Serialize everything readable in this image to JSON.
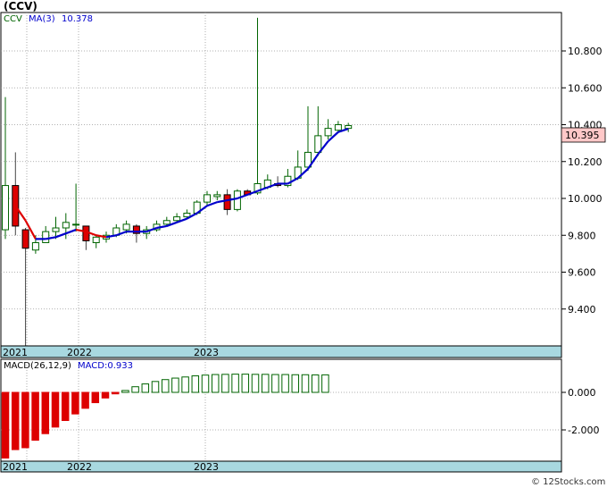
{
  "header": {
    "title": "(CCV)"
  },
  "price_legend": {
    "ticker": "CCV",
    "ma_label": "MA(3)",
    "ma_value": "10.378"
  },
  "last_price_label": "10.395",
  "macd_legend": {
    "label": "MACD(26,12,9)",
    "value_label": "MACD:0.933"
  },
  "credit": "© 12Stocks.com",
  "colors": {
    "up_candle_border": "#006400",
    "down_candle_fill": "#dd0000",
    "ma_up": "#0000cc",
    "ma_down": "#dd0000",
    "macd_pos": "#006400",
    "macd_neg": "#dd0000",
    "axis_band": "#a8d8e0"
  },
  "chart_data": [
    {
      "type": "candlestick",
      "title": "(CCV)",
      "period": "monthly",
      "x_labels": [
        "2021",
        "2022",
        "2023"
      ],
      "ylim": [
        9.2,
        11.0
      ],
      "y_ticks": [
        "9.400",
        "9.600",
        "9.800",
        "10.000",
        "10.200",
        "10.400",
        "10.600",
        "10.800"
      ],
      "grid": true,
      "candles": [
        {
          "o": 9.83,
          "h": 10.55,
          "l": 9.78,
          "c": 10.07
        },
        {
          "o": 10.07,
          "h": 10.25,
          "l": 9.8,
          "c": 9.85
        },
        {
          "o": 9.83,
          "h": 9.84,
          "l": 9.2,
          "c": 9.73
        },
        {
          "o": 9.72,
          "h": 9.8,
          "l": 9.7,
          "c": 9.76
        },
        {
          "o": 9.76,
          "h": 9.85,
          "l": 9.76,
          "c": 9.82
        },
        {
          "o": 9.82,
          "h": 9.9,
          "l": 9.78,
          "c": 9.84
        },
        {
          "o": 9.84,
          "h": 9.92,
          "l": 9.78,
          "c": 9.87
        },
        {
          "o": 9.86,
          "h": 10.08,
          "l": 9.82,
          "c": 9.86
        },
        {
          "o": 9.85,
          "h": 9.85,
          "l": 9.72,
          "c": 9.77
        },
        {
          "o": 9.76,
          "h": 9.8,
          "l": 9.73,
          "c": 9.79
        },
        {
          "o": 9.78,
          "h": 9.82,
          "l": 9.76,
          "c": 9.8
        },
        {
          "o": 9.8,
          "h": 9.86,
          "l": 9.79,
          "c": 9.84
        },
        {
          "o": 9.83,
          "h": 9.88,
          "l": 9.81,
          "c": 9.86
        },
        {
          "o": 9.85,
          "h": 9.86,
          "l": 9.76,
          "c": 9.81
        },
        {
          "o": 9.81,
          "h": 9.85,
          "l": 9.78,
          "c": 9.83
        },
        {
          "o": 9.83,
          "h": 9.88,
          "l": 9.82,
          "c": 9.86
        },
        {
          "o": 9.86,
          "h": 9.9,
          "l": 9.85,
          "c": 9.88
        },
        {
          "o": 9.88,
          "h": 9.92,
          "l": 9.87,
          "c": 9.9
        },
        {
          "o": 9.9,
          "h": 9.94,
          "l": 9.89,
          "c": 9.92
        },
        {
          "o": 9.92,
          "h": 9.99,
          "l": 9.91,
          "c": 9.98
        },
        {
          "o": 9.98,
          "h": 10.04,
          "l": 9.96,
          "c": 10.02
        },
        {
          "o": 10.01,
          "h": 10.04,
          "l": 9.99,
          "c": 10.02
        },
        {
          "o": 10.02,
          "h": 10.05,
          "l": 9.91,
          "c": 9.94
        },
        {
          "o": 9.94,
          "h": 10.05,
          "l": 9.93,
          "c": 10.04
        },
        {
          "o": 10.04,
          "h": 10.05,
          "l": 10.02,
          "c": 10.02
        },
        {
          "o": 10.03,
          "h": 10.98,
          "l": 10.02,
          "c": 10.08
        },
        {
          "o": 10.06,
          "h": 10.13,
          "l": 10.05,
          "c": 10.1
        },
        {
          "o": 10.08,
          "h": 10.12,
          "l": 10.06,
          "c": 10.07
        },
        {
          "o": 10.07,
          "h": 10.16,
          "l": 10.06,
          "c": 10.12
        },
        {
          "o": 10.11,
          "h": 10.26,
          "l": 10.1,
          "c": 10.17
        },
        {
          "o": 10.17,
          "h": 10.5,
          "l": 10.15,
          "c": 10.25
        },
        {
          "o": 10.25,
          "h": 10.5,
          "l": 10.23,
          "c": 10.34
        },
        {
          "o": 10.34,
          "h": 10.43,
          "l": 10.32,
          "c": 10.38
        },
        {
          "o": 10.37,
          "h": 10.42,
          "l": 10.36,
          "c": 10.4
        },
        {
          "o": 10.38,
          "h": 10.41,
          "l": 10.36,
          "c": 10.395
        }
      ],
      "ma": [
        null,
        9.96,
        9.88,
        9.78,
        9.78,
        9.79,
        9.81,
        9.83,
        9.82,
        9.8,
        9.79,
        9.8,
        9.82,
        9.82,
        9.82,
        9.84,
        9.85,
        9.87,
        9.89,
        9.92,
        9.96,
        9.98,
        9.99,
        10.0,
        10.02,
        10.04,
        10.06,
        10.08,
        10.08,
        10.11,
        10.16,
        10.24,
        10.31,
        10.36,
        10.378
      ]
    },
    {
      "type": "bar",
      "title": "MACD(26,12,9)",
      "ylim": [
        -3.6,
        1.8
      ],
      "y_ticks": [
        "0.000",
        "-2.000"
      ],
      "x_labels": [
        "2021",
        "2022",
        "2023"
      ],
      "values": [
        -3.5,
        -3.05,
        -2.95,
        -2.55,
        -2.2,
        -1.85,
        -1.5,
        -1.15,
        -0.85,
        -0.55,
        -0.3,
        -0.08,
        0.1,
        0.3,
        0.45,
        0.58,
        0.68,
        0.76,
        0.82,
        0.88,
        0.92,
        0.95,
        0.96,
        0.97,
        0.97,
        0.96,
        0.96,
        0.95,
        0.95,
        0.94,
        0.94,
        0.93,
        0.933
      ]
    }
  ]
}
